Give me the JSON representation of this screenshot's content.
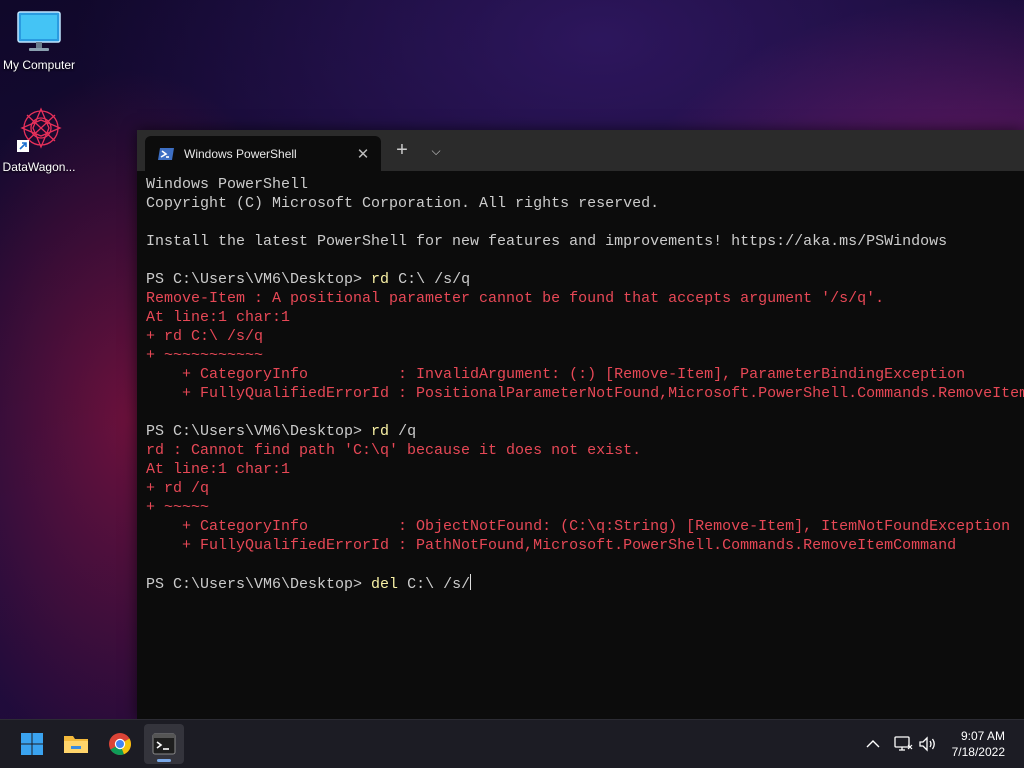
{
  "desktop": {
    "icons": [
      {
        "label": "My Computer",
        "icon": "monitor-icon"
      },
      {
        "label": "DataWagon...",
        "icon": "datawagon-shortcut-icon"
      }
    ]
  },
  "window": {
    "tab_title": "Windows PowerShell",
    "tab_close": "✕",
    "new_tab": "+",
    "dropdown": "⌵"
  },
  "console": {
    "lines": [
      {
        "text": "Windows PowerShell",
        "type": "out"
      },
      {
        "text": "Copyright (C) Microsoft Corporation. All rights reserved.",
        "type": "out"
      },
      {
        "text": "",
        "type": "out"
      },
      {
        "text": "Install the latest PowerShell for new features and improvements! https://aka.ms/PSWindows",
        "type": "out"
      },
      {
        "text": "",
        "type": "out"
      },
      {
        "prompt": "PS C:\\Users\\VM6\\Desktop> ",
        "command": "rd",
        "args": " C:\\ /s/q",
        "type": "prompt"
      },
      {
        "text": "Remove-Item : A positional parameter cannot be found that accepts argument '/s/q'.",
        "type": "err"
      },
      {
        "text": "At line:1 char:1",
        "type": "err"
      },
      {
        "text": "+ rd C:\\ /s/q",
        "type": "err"
      },
      {
        "text": "+ ~~~~~~~~~~~",
        "type": "err"
      },
      {
        "text": "    + CategoryInfo          : InvalidArgument: (:) [Remove-Item], ParameterBindingException",
        "type": "err"
      },
      {
        "text": "    + FullyQualifiedErrorId : PositionalParameterNotFound,Microsoft.PowerShell.Commands.RemoveItemCommand",
        "type": "err"
      },
      {
        "text": "",
        "type": "out"
      },
      {
        "prompt": "PS C:\\Users\\VM6\\Desktop> ",
        "command": "rd",
        "args": " /q",
        "type": "prompt"
      },
      {
        "text": "rd : Cannot find path 'C:\\q' because it does not exist.",
        "type": "err"
      },
      {
        "text": "At line:1 char:1",
        "type": "err"
      },
      {
        "text": "+ rd /q",
        "type": "err"
      },
      {
        "text": "+ ~~~~~",
        "type": "err"
      },
      {
        "text": "    + CategoryInfo          : ObjectNotFound: (C:\\q:String) [Remove-Item], ItemNotFoundException",
        "type": "err"
      },
      {
        "text": "    + FullyQualifiedErrorId : PathNotFound,Microsoft.PowerShell.Commands.RemoveItemCommand",
        "type": "err"
      },
      {
        "text": "",
        "type": "out"
      },
      {
        "prompt": "PS C:\\Users\\VM6\\Desktop> ",
        "command": "del",
        "args": " C:\\ /s/",
        "type": "prompt",
        "cursor": true
      }
    ]
  },
  "taskbar": {
    "apps": [
      {
        "name": "start-button",
        "icon": "windows-logo-icon"
      },
      {
        "name": "file-explorer",
        "icon": "folder-icon"
      },
      {
        "name": "chrome",
        "icon": "chrome-icon"
      },
      {
        "name": "terminal",
        "icon": "terminal-icon",
        "active": true
      }
    ],
    "tray": {
      "chevron": "^",
      "network_icon": "network-icon",
      "volume_icon": "volume-icon"
    },
    "clock": {
      "time": "9:07 AM",
      "date": "7/18/2022"
    }
  }
}
